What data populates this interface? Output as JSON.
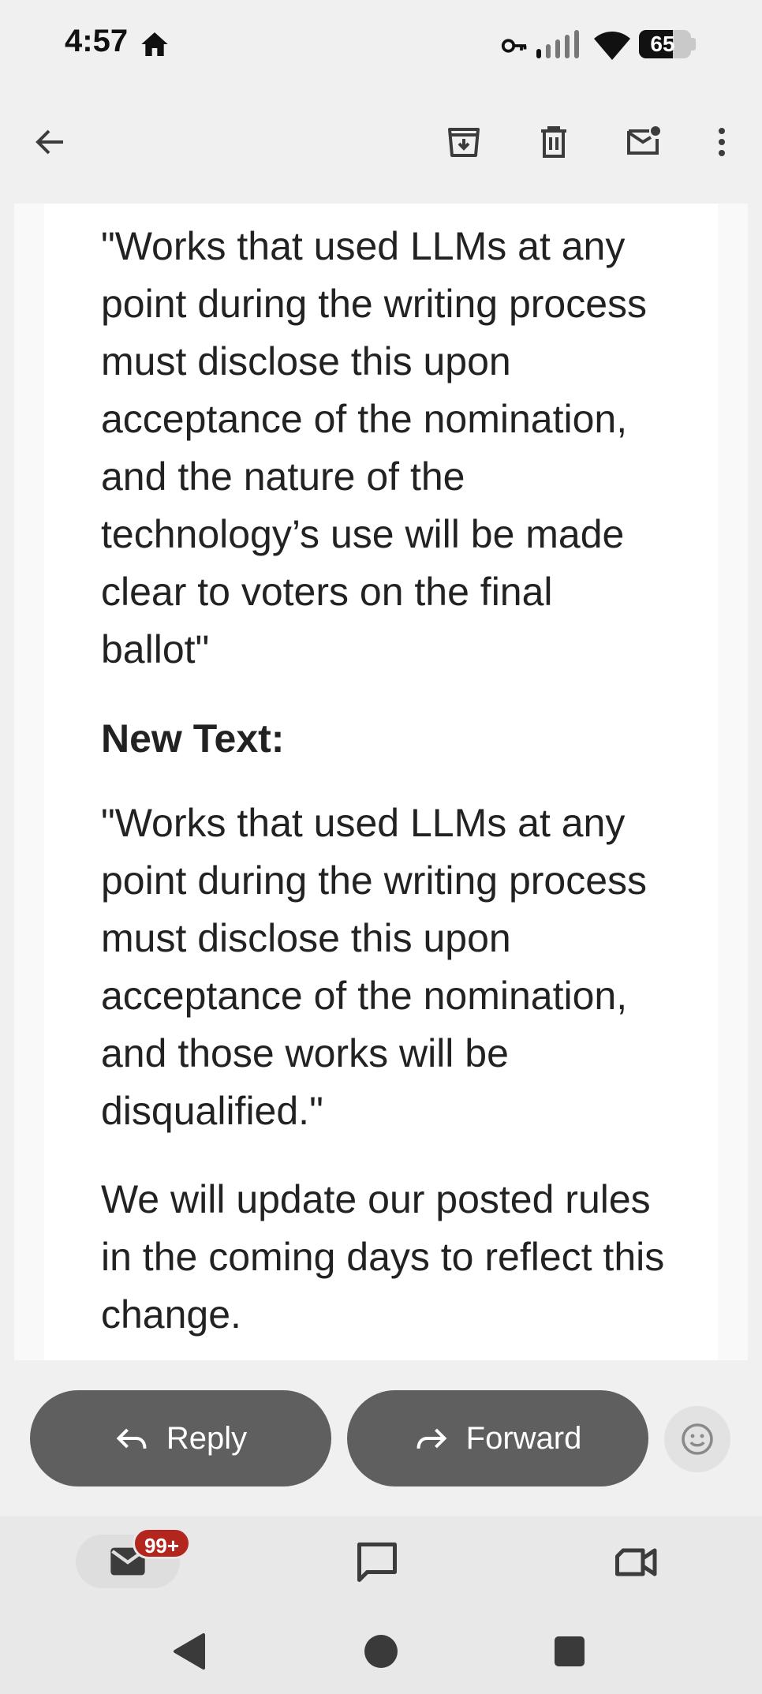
{
  "status_bar": {
    "time": "4:57",
    "battery_level": "65",
    "battery_fraction": 0.65,
    "icons": [
      "home-icon",
      "vpn-key-icon",
      "signal-icon",
      "wifi-icon",
      "battery-icon"
    ]
  },
  "toolbar": {
    "icons": [
      "back-arrow-icon",
      "archive-icon",
      "delete-icon",
      "mark-unread-icon",
      "more-vert-icon"
    ]
  },
  "email": {
    "old_text": "\"Works that used LLMs at any point during the writing process must disclose this upon acceptance of the nomination, and the nature of the technology’s use will be made clear to voters on the final ballot\"",
    "new_text_heading": "New Text:",
    "new_text": "\"Works that used LLMs at any point during the writing process must disclose this upon acceptance of the nomination, and those works will be disqualified.\"",
    "closing": "We will update our posted rules in the coming days to reflect this change."
  },
  "actions": {
    "reply_label": "Reply",
    "forward_label": "Forward",
    "emoji_icon": "add-reaction-icon"
  },
  "bottom_nav": {
    "mail_badge": "99+",
    "items": [
      "mail-icon",
      "chat-icon",
      "meet-icon"
    ]
  },
  "system_nav": [
    "back-triangle-icon",
    "home-circle-icon",
    "recents-square-icon"
  ],
  "colors": {
    "background": "#f0f0f0",
    "button": "#5f5f5f",
    "badge": "#b3261e"
  }
}
